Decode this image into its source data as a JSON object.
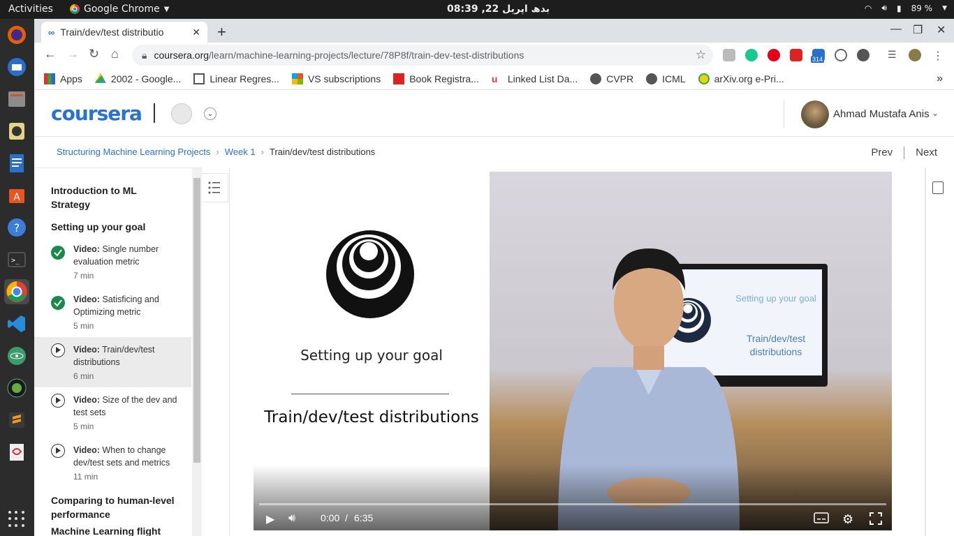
{
  "os": {
    "activities": "Activities",
    "app_name": "Google Chrome",
    "clock": "بدھ اپریل 22, 08:39",
    "battery": "89 %"
  },
  "browser": {
    "tab_title": "Train/dev/test distributio",
    "url_host": "coursera.org",
    "url_path": "/learn/machine-learning-projects/lecture/78P8f/train-dev-test-distributions",
    "ext_badge": "314",
    "bookmarks": [
      {
        "label": "Apps",
        "icon": "apps-grid-icon"
      },
      {
        "label": "2002 - Google...",
        "icon": "google-drive-icon"
      },
      {
        "label": "Linear Regres...",
        "icon": "document-icon"
      },
      {
        "label": "VS subscriptions",
        "icon": "microsoft-icon"
      },
      {
        "label": "Book Registra...",
        "icon": "it-logo-icon"
      },
      {
        "label": "Linked List Da...",
        "icon": "udemy-icon"
      },
      {
        "label": "CVPR",
        "icon": "globe-icon"
      },
      {
        "label": "ICML",
        "icon": "globe-icon"
      },
      {
        "label": "arXiv.org e-Pri...",
        "icon": "arxiv-icon"
      }
    ]
  },
  "header": {
    "logo": "coursera",
    "user_name": "Ahmad Mustafa Anis"
  },
  "breadcrumb": {
    "course": "Structuring Machine Learning Projects",
    "week": "Week 1",
    "current": "Train/dev/test distributions",
    "prev": "Prev",
    "next": "Next"
  },
  "sidebar": {
    "section1": "Introduction to ML Strategy",
    "section2": "Setting up your goal",
    "lessons": [
      {
        "type": "Video:",
        "title": "Single number evaluation metric",
        "duration": "7 min",
        "status": "completed"
      },
      {
        "type": "Video:",
        "title": "Satisficing and Optimizing metric",
        "duration": "5 min",
        "status": "completed"
      },
      {
        "type": "Video:",
        "title": "Train/dev/test distributions",
        "duration": "6 min",
        "status": "current"
      },
      {
        "type": "Video:",
        "title": "Size of the dev and test sets",
        "duration": "5 min",
        "status": "not-started"
      },
      {
        "type": "Video:",
        "title": "When to change dev/test sets and metrics",
        "duration": "11 min",
        "status": "not-started"
      }
    ],
    "section3": "Comparing to human-level performance",
    "section4": "Machine Learning flight"
  },
  "video": {
    "slide_heading": "Setting up your goal",
    "slide_title": "Train/dev/test distributions",
    "monitor_heading": "Setting up your goal",
    "monitor_title": "Train/dev/test distributions",
    "time_current": "0:00",
    "time_sep": "/",
    "time_total": "6:35",
    "progress": 0
  }
}
